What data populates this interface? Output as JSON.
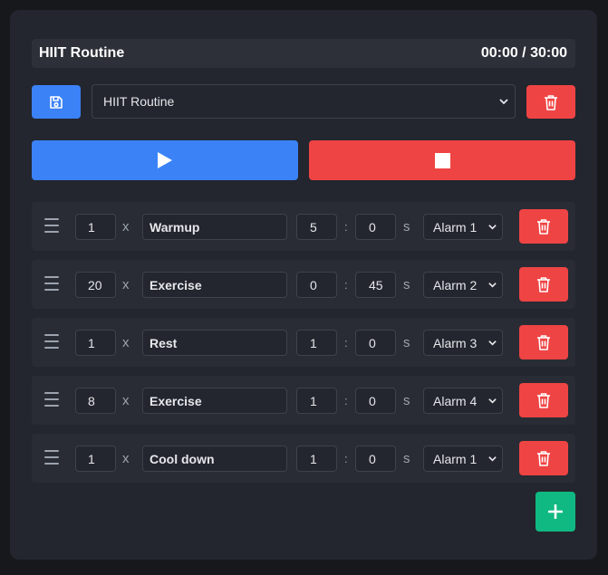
{
  "header": {
    "title": "HIIT Routine",
    "time": "00:00 / 30:00"
  },
  "routine_select": {
    "value": "HIIT Routine"
  },
  "rows": [
    {
      "reps": "1",
      "x": "x",
      "name": "Warmup",
      "mins": "5",
      "colon": ":",
      "secs": "0",
      "unit": "s",
      "alarm": "Alarm 1"
    },
    {
      "reps": "20",
      "x": "x",
      "name": "Exercise",
      "mins": "0",
      "colon": ":",
      "secs": "45",
      "unit": "s",
      "alarm": "Alarm 2"
    },
    {
      "reps": "1",
      "x": "x",
      "name": "Rest",
      "mins": "1",
      "colon": ":",
      "secs": "0",
      "unit": "s",
      "alarm": "Alarm 3"
    },
    {
      "reps": "8",
      "x": "x",
      "name": "Exercise",
      "mins": "1",
      "colon": ":",
      "secs": "0",
      "unit": "s",
      "alarm": "Alarm 4"
    },
    {
      "reps": "1",
      "x": "x",
      "name": "Cool down",
      "mins": "1",
      "colon": ":",
      "secs": "0",
      "unit": "s",
      "alarm": "Alarm 1"
    }
  ],
  "colors": {
    "blue": "#3b82f6",
    "red": "#ef4444",
    "green": "#10b981",
    "panel": "#23262e"
  },
  "icons": {
    "save": "floppy-disk-icon",
    "delete": "trash-icon",
    "play": "play-icon",
    "stop": "stop-icon",
    "add": "plus-icon",
    "drag": "drag-handle-icon",
    "chevron": "chevron-down-icon"
  }
}
